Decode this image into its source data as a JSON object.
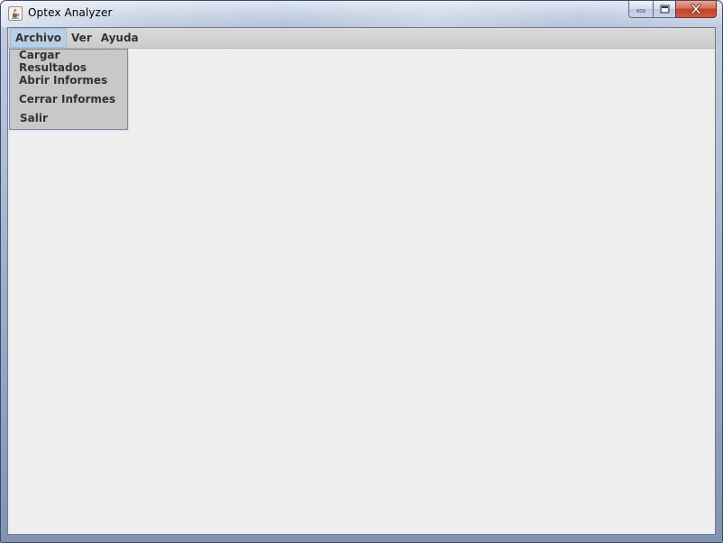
{
  "window": {
    "title": "Optex Analyzer",
    "icon": "java-cup-icon"
  },
  "caption_buttons": {
    "minimize": "minimize-icon",
    "maximize": "maximize-icon",
    "close": "close-icon"
  },
  "menubar": {
    "menus": [
      {
        "label": "Archivo",
        "active": true
      },
      {
        "label": "Ver",
        "active": false
      },
      {
        "label": "Ayuda",
        "active": false
      }
    ]
  },
  "archivo_menu": {
    "items": [
      {
        "label": "Cargar Resultados"
      },
      {
        "label": "Abrir Informes"
      },
      {
        "label": "Cerrar Informes"
      },
      {
        "label": "Salir"
      }
    ]
  },
  "colors": {
    "menu_highlight": "#b8cfe5",
    "dropdown_bg": "#c8c8c8",
    "client_bg": "#eeeeee"
  }
}
